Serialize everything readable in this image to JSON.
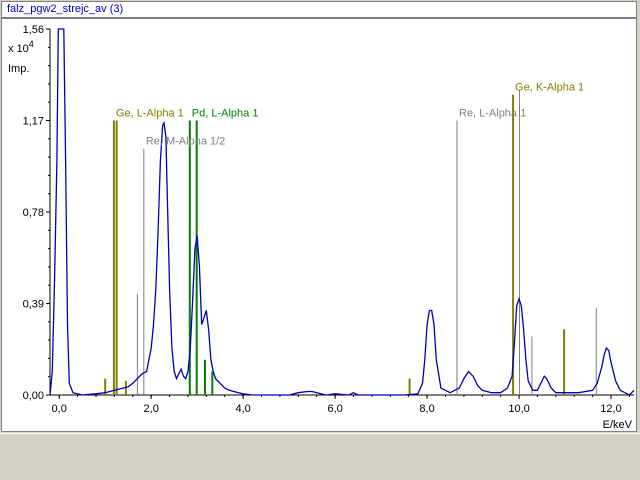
{
  "window": {
    "title": "falz_pgw2_strejc_av (3)"
  },
  "chart_data": {
    "type": "line",
    "title": "",
    "xlabel": "E/keV",
    "ylabel": "Imp.",
    "y_multiplier_label": "x 10",
    "y_multiplier_exponent": "4",
    "xlim": [
      -0.2,
      12.5
    ],
    "ylim": [
      0,
      1.56
    ],
    "x_ticks": [
      0.0,
      2.0,
      4.0,
      6.0,
      8.0,
      10.0,
      12.0
    ],
    "x_tick_labels": [
      "0,0",
      "2,0",
      "4,0",
      "6,0",
      "8,0",
      "10,0",
      "12,0"
    ],
    "y_ticks": [
      0.0,
      0.39,
      0.78,
      1.17,
      1.56
    ],
    "y_tick_labels": [
      "0,00",
      "0,39",
      "0,78",
      "1,17",
      "1,56"
    ],
    "colors": {
      "spectrum": "#0000b4",
      "ge_lines": "#808000",
      "pd_lines": "#008000",
      "re_lines": "#808080",
      "axis": "#000000"
    },
    "series": [
      {
        "style": "spectrum",
        "x": [
          -0.2,
          -0.15,
          -0.1,
          -0.05,
          -0.02,
          0.0,
          0.05,
          0.1,
          0.14,
          0.18,
          0.22,
          0.3,
          0.5,
          0.8,
          1.0,
          1.1,
          1.2,
          1.3,
          1.4,
          1.5,
          1.6,
          1.7,
          1.8,
          1.9,
          2.0,
          2.05,
          2.1,
          2.15,
          2.2,
          2.25,
          2.28,
          2.32,
          2.35,
          2.4,
          2.45,
          2.5,
          2.55,
          2.6,
          2.65,
          2.7,
          2.75,
          2.8,
          2.85,
          2.9,
          2.95,
          3.0,
          3.05,
          3.1,
          3.15,
          3.2,
          3.25,
          3.3,
          3.35,
          3.4,
          3.5,
          3.6,
          3.7,
          3.8,
          3.9,
          4.0,
          4.2,
          4.5,
          5.0,
          5.2,
          5.4,
          5.5,
          5.6,
          5.8,
          6.0,
          6.3,
          6.4,
          6.5,
          7.0,
          7.5,
          7.8,
          7.9,
          7.95,
          8.0,
          8.05,
          8.1,
          8.15,
          8.2,
          8.3,
          8.5,
          8.7,
          8.8,
          8.9,
          9.0,
          9.1,
          9.2,
          9.4,
          9.6,
          9.75,
          9.85,
          9.9,
          9.95,
          10.0,
          10.05,
          10.1,
          10.15,
          10.2,
          10.3,
          10.4,
          10.5,
          10.55,
          10.6,
          10.7,
          10.8,
          11.0,
          11.3,
          11.6,
          11.7,
          11.8,
          11.85,
          11.9,
          11.95,
          12.0,
          12.1,
          12.2,
          12.4,
          12.5
        ],
        "y": [
          0.0,
          0.1,
          0.5,
          1.0,
          1.56,
          1.56,
          1.56,
          1.56,
          1.0,
          0.3,
          0.05,
          0.01,
          0.0,
          0.005,
          0.01,
          0.015,
          0.02,
          0.025,
          0.03,
          0.035,
          0.05,
          0.07,
          0.09,
          0.1,
          0.2,
          0.3,
          0.45,
          0.7,
          1.0,
          1.15,
          1.16,
          1.1,
          0.85,
          0.45,
          0.2,
          0.1,
          0.07,
          0.09,
          0.11,
          0.08,
          0.07,
          0.1,
          0.2,
          0.4,
          0.62,
          0.68,
          0.55,
          0.3,
          0.33,
          0.36,
          0.28,
          0.15,
          0.1,
          0.07,
          0.05,
          0.03,
          0.02,
          0.015,
          0.01,
          0.005,
          0.0,
          0.0,
          0.0,
          0.01,
          0.015,
          0.015,
          0.01,
          0.0,
          0.005,
          0.0,
          0.01,
          0.0,
          0.0,
          0.0,
          0.005,
          0.05,
          0.15,
          0.3,
          0.36,
          0.36,
          0.3,
          0.15,
          0.03,
          0.01,
          0.03,
          0.07,
          0.1,
          0.08,
          0.04,
          0.02,
          0.01,
          0.01,
          0.03,
          0.08,
          0.22,
          0.38,
          0.41,
          0.38,
          0.28,
          0.15,
          0.06,
          0.02,
          0.02,
          0.06,
          0.08,
          0.07,
          0.03,
          0.01,
          0.01,
          0.01,
          0.02,
          0.05,
          0.12,
          0.17,
          0.2,
          0.19,
          0.14,
          0.06,
          0.02,
          0.0,
          0.02
        ]
      }
    ],
    "element_lines": [
      {
        "group": "ge",
        "x": 1.19,
        "y": 1.17
      },
      {
        "group": "ge",
        "x": 1.25,
        "y": 1.17
      },
      {
        "group": "ge",
        "x": 1.0,
        "y": 0.07
      },
      {
        "group": "ge",
        "x": 1.45,
        "y": 0.06
      },
      {
        "group": "ge",
        "x": 9.87,
        "y": 1.28
      },
      {
        "group": "ge",
        "x": 10.98,
        "y": 0.28
      },
      {
        "group": "ge",
        "x": 7.62,
        "y": 0.07
      },
      {
        "group": "pd",
        "x": 2.84,
        "y": 1.17
      },
      {
        "group": "pd",
        "x": 2.99,
        "y": 1.17
      },
      {
        "group": "pd",
        "x": 3.17,
        "y": 0.15
      },
      {
        "group": "pd",
        "x": 3.33,
        "y": 0.1
      },
      {
        "group": "re",
        "x": 1.84,
        "y": 1.05
      },
      {
        "group": "re",
        "x": 1.7,
        "y": 0.43
      },
      {
        "group": "re",
        "x": 8.65,
        "y": 1.17
      },
      {
        "group": "re",
        "x": 10.01,
        "y": 1.3
      },
      {
        "group": "re",
        "x": 10.28,
        "y": 0.25
      },
      {
        "group": "re",
        "x": 11.68,
        "y": 0.37
      }
    ],
    "annotations": [
      {
        "text": "Ge, L-Alpha 1",
        "group": "ge",
        "x": 1.19,
        "y": 1.17
      },
      {
        "text": "Pd, L-Alpha 1",
        "group": "pd",
        "x": 2.84,
        "y": 1.17
      },
      {
        "text": "Re, M-Alpha 1/2",
        "group": "re",
        "x": 1.84,
        "y": 1.05
      },
      {
        "text": "Re, L-Alpha 1",
        "group": "re",
        "x": 8.65,
        "y": 1.17
      },
      {
        "text": "Ge, K-Alpha 1",
        "group": "ge",
        "x": 9.87,
        "y": 1.28
      }
    ]
  }
}
